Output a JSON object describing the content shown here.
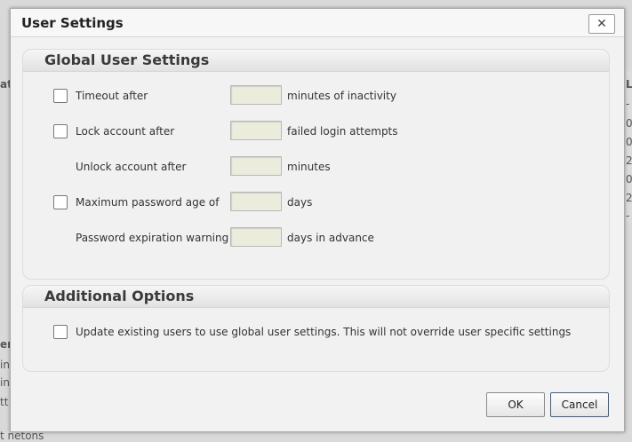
{
  "background": {
    "fragments": [
      "atu",
      "er",
      "ini",
      "ini",
      "tt",
      "t  netons"
    ],
    "right_fragments": [
      "L",
      "-",
      "0",
      "0",
      "2",
      "0",
      "2",
      "-"
    ]
  },
  "dialog": {
    "title": "User Settings",
    "close_label": "✕"
  },
  "global_section": {
    "title": "Global User Settings",
    "rows": [
      {
        "label": "Timeout after",
        "suffix": "minutes of inactivity",
        "has_checkbox": true,
        "checked": false,
        "value": ""
      },
      {
        "label": "Lock account after",
        "suffix": "failed login attempts",
        "has_checkbox": true,
        "checked": false,
        "value": ""
      },
      {
        "label": "Unlock account after",
        "suffix": "minutes",
        "has_checkbox": false,
        "value": ""
      },
      {
        "label": "Maximum password age of",
        "suffix": "days",
        "has_checkbox": true,
        "checked": false,
        "value": ""
      },
      {
        "label": "Password expiration warning",
        "suffix": "days in advance",
        "has_checkbox": false,
        "value": ""
      }
    ]
  },
  "additional_section": {
    "title": "Additional Options",
    "update_label": "Update existing users to use global user settings. This will not override user specific settings",
    "checked": false
  },
  "buttons": {
    "ok": "OK",
    "cancel": "Cancel"
  }
}
